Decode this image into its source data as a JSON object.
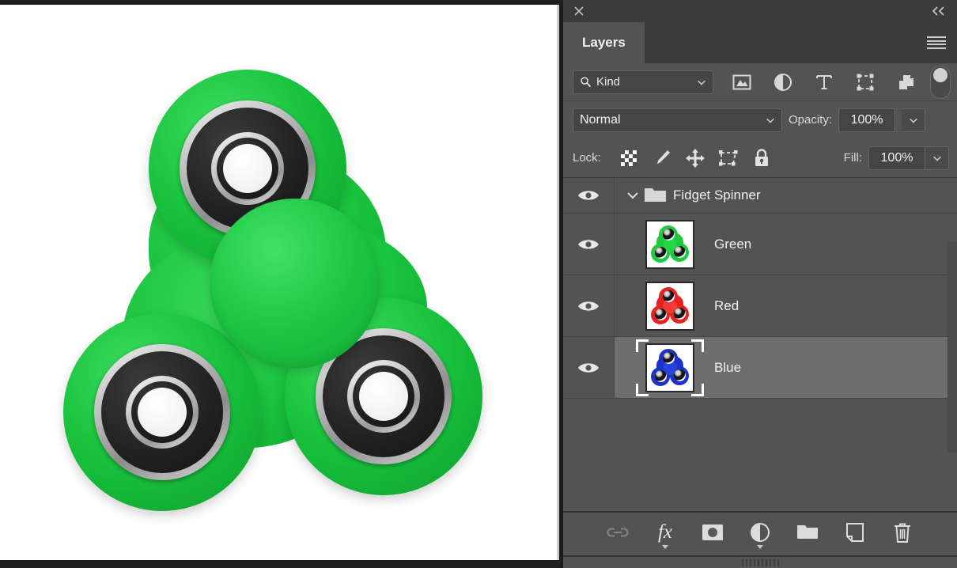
{
  "app": {
    "window_title": "Layers",
    "accent_selected_row": "#6e6e6e",
    "panel_bg": "#535353",
    "panel_dark": "#3c3c3c"
  },
  "titlebar": {
    "close_icon": "close-icon",
    "collapse_label": "«"
  },
  "tabs": [
    {
      "label": "Layers",
      "active": true
    }
  ],
  "menu": {
    "icon": "hamburger-menu-icon"
  },
  "filter_row": {
    "kind_label": "Kind",
    "search_icon": "search-icon",
    "chevron_icon": "chevron-down-icon",
    "icons": [
      {
        "name": "filter-pixel-layers-icon",
        "title": "Pixel layers"
      },
      {
        "name": "filter-adjustment-layers-icon",
        "title": "Adjustment layers"
      },
      {
        "name": "filter-type-layers-icon",
        "title": "Type layers",
        "glyph": "T"
      },
      {
        "name": "filter-shape-layers-icon",
        "title": "Shape layers"
      },
      {
        "name": "filter-smart-object-layers-icon",
        "title": "Smart objects"
      }
    ],
    "toggle": {
      "name": "filter-enable-toggle",
      "state": "off"
    }
  },
  "blend_row": {
    "blend_mode": "Normal",
    "opacity_label": "Opacity:",
    "opacity_value": "100%"
  },
  "lock_row": {
    "lock_label": "Lock:",
    "icons": [
      {
        "name": "lock-transparent-pixels-icon"
      },
      {
        "name": "lock-image-pixels-icon"
      },
      {
        "name": "lock-position-icon"
      },
      {
        "name": "lock-artboard-nesting-icon"
      },
      {
        "name": "lock-all-icon"
      }
    ],
    "fill_label": "Fill:",
    "fill_value": "100%"
  },
  "layers": [
    {
      "name": "Fidget Spinner",
      "type": "group",
      "visible": true,
      "expanded": true,
      "selected": false
    },
    {
      "name": "Green",
      "type": "layer",
      "visible": true,
      "selected": false,
      "thumbnail_color": "#1fc93f"
    },
    {
      "name": "Red",
      "type": "layer",
      "visible": true,
      "selected": false,
      "thumbnail_color": "#e8231f"
    },
    {
      "name": "Blue",
      "type": "layer",
      "visible": true,
      "selected": true,
      "thumbnail_color": "#1c32c8"
    }
  ],
  "bottom_toolbar": [
    {
      "name": "link-layers-button",
      "label": "Link layers",
      "disabled": true
    },
    {
      "name": "layer-styles-button",
      "label": "fx",
      "has_menu": true
    },
    {
      "name": "add-layer-mask-button",
      "label": "Add layer mask"
    },
    {
      "name": "new-adjustment-layer-button",
      "label": "New adjustment layer",
      "has_menu": true
    },
    {
      "name": "new-group-button",
      "label": "New group"
    },
    {
      "name": "new-layer-button",
      "label": "New layer"
    },
    {
      "name": "delete-layer-button",
      "label": "Delete layer"
    }
  ],
  "canvas": {
    "document_background": "#ffffff",
    "artwork": "fidget-spinner",
    "artwork_color": "#1cc33f"
  }
}
